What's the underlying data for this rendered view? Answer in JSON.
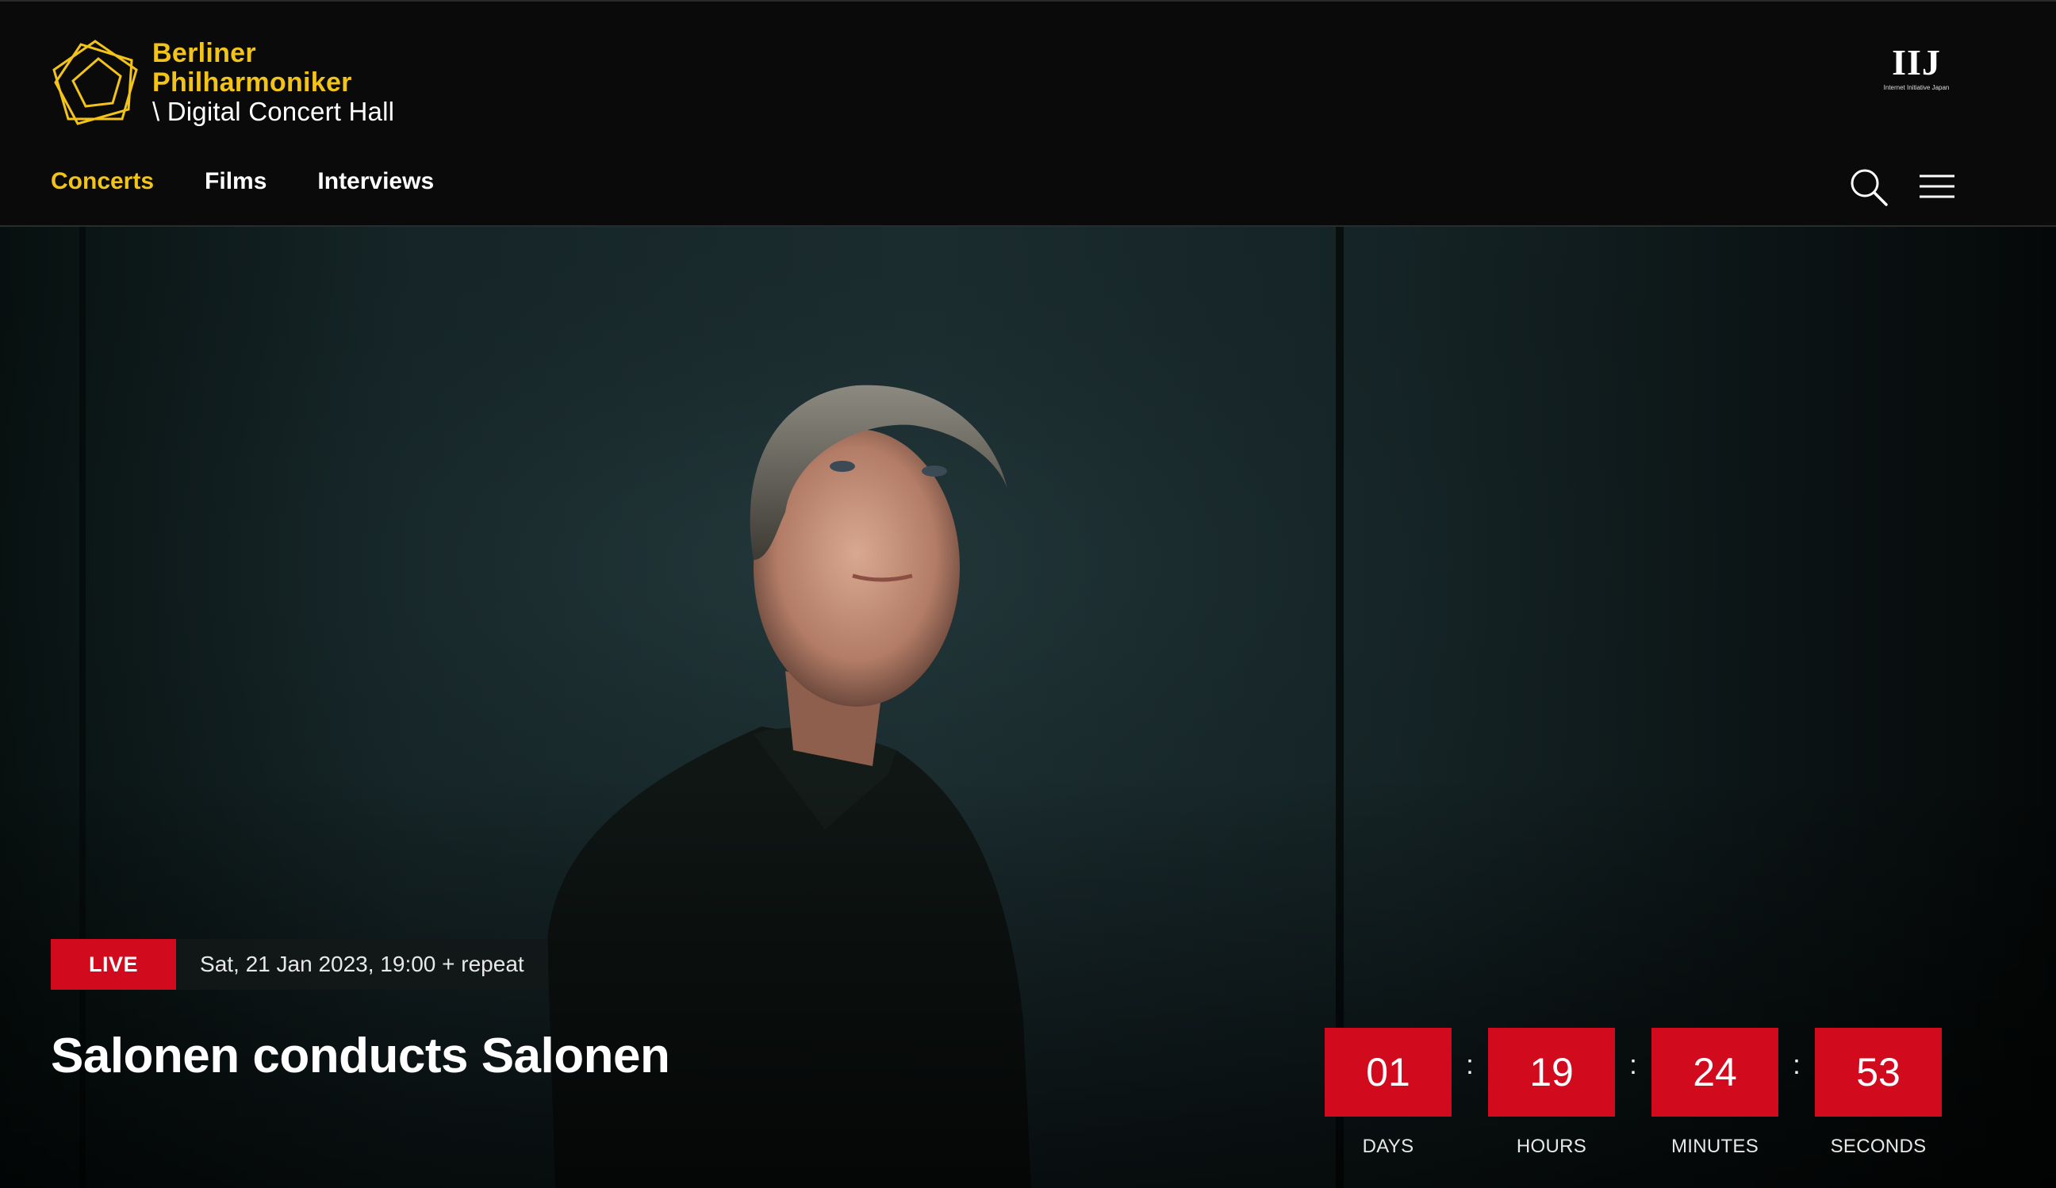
{
  "brand": {
    "name_line1": "Berliner Philharmoniker",
    "name_line2": "\\ Digital Concert Hall",
    "accent_color": "#f2c319",
    "logo_icon": "pentagon-logo-icon"
  },
  "sponsor": {
    "mark": "IIJ",
    "subtitle": "Internet Initiative Japan"
  },
  "nav": {
    "items": [
      {
        "label": "Concerts",
        "active": true
      },
      {
        "label": "Films",
        "active": false
      },
      {
        "label": "Interviews",
        "active": false
      }
    ]
  },
  "toolbar": {
    "search_icon": "search-icon",
    "menu_icon": "hamburger-menu-icon"
  },
  "hero": {
    "badge": "LIVE",
    "badge_color": "#d20a1e",
    "date": "Sat, 21 Jan 2023, 19:00 + repeat",
    "title": "Salonen conducts Salonen"
  },
  "countdown": {
    "separator": ":",
    "units": [
      {
        "value": "01",
        "label": "DAYS"
      },
      {
        "value": "19",
        "label": "HOURS"
      },
      {
        "value": "24",
        "label": "MINUTES"
      },
      {
        "value": "53",
        "label": "SECONDS"
      }
    ]
  }
}
